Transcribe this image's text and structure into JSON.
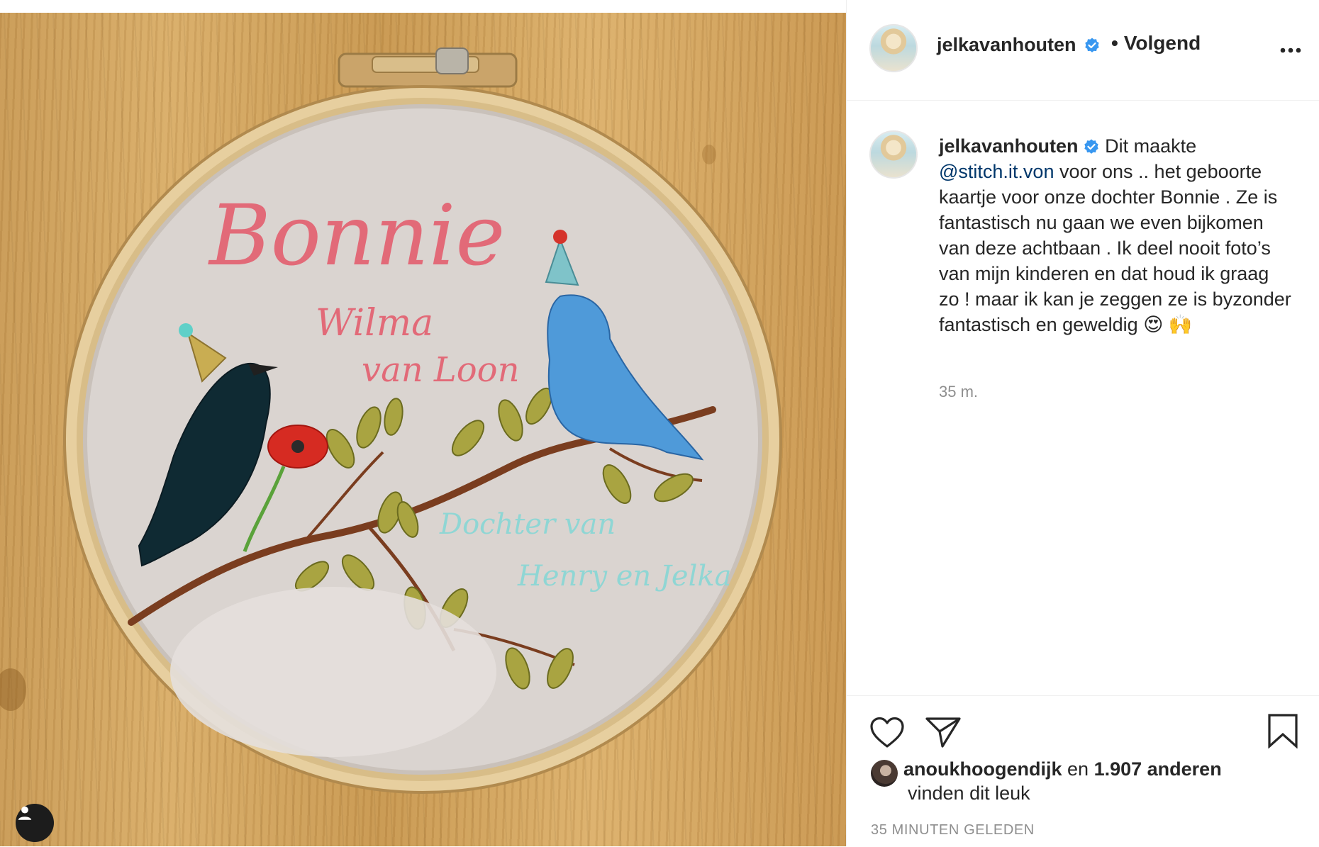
{
  "photo": {
    "embroidery": {
      "name": "Bonnie",
      "line2": "Wilma",
      "line3": "van Loon",
      "line4": "Dochter van",
      "line5": "Henry en Jelka"
    }
  },
  "header": {
    "username": "jelkavanhouten",
    "follow_status": "Volgend",
    "dot": "•",
    "more_icon": "more-horizontal-icon",
    "verified_icon": "verified-badge-icon"
  },
  "caption": {
    "username": "jelkavanhouten",
    "text_before_mention": "Dit maakte",
    "mention": "@stitch.it.von",
    "text_after_mention": "voor ons .. het geboorte kaartje voor onze dochter Bonnie . Ze is fantastisch nu gaan we even bijkomen van deze achtbaan . Ik deel nooit foto’s van mijn kinderen en dat houd ik graag zo ! maar ik kan je zeggen ze is byzonder fantastisch en geweldig",
    "emoji": "😍 🙌",
    "time": "35 m."
  },
  "actions": {
    "like_icon": "heart-icon",
    "share_icon": "send-icon",
    "save_icon": "bookmark-icon"
  },
  "likes": {
    "first_liker": "anoukhoogendijk",
    "connector": "en",
    "others": "1.907 anderen",
    "suffix": "vinden dit leuk"
  },
  "posted_ago": "35 MINUTEN GELEDEN",
  "colors": {
    "link": "#00376b",
    "verified": "#3897f0",
    "muted": "#8e8e8e",
    "text": "#262626"
  }
}
